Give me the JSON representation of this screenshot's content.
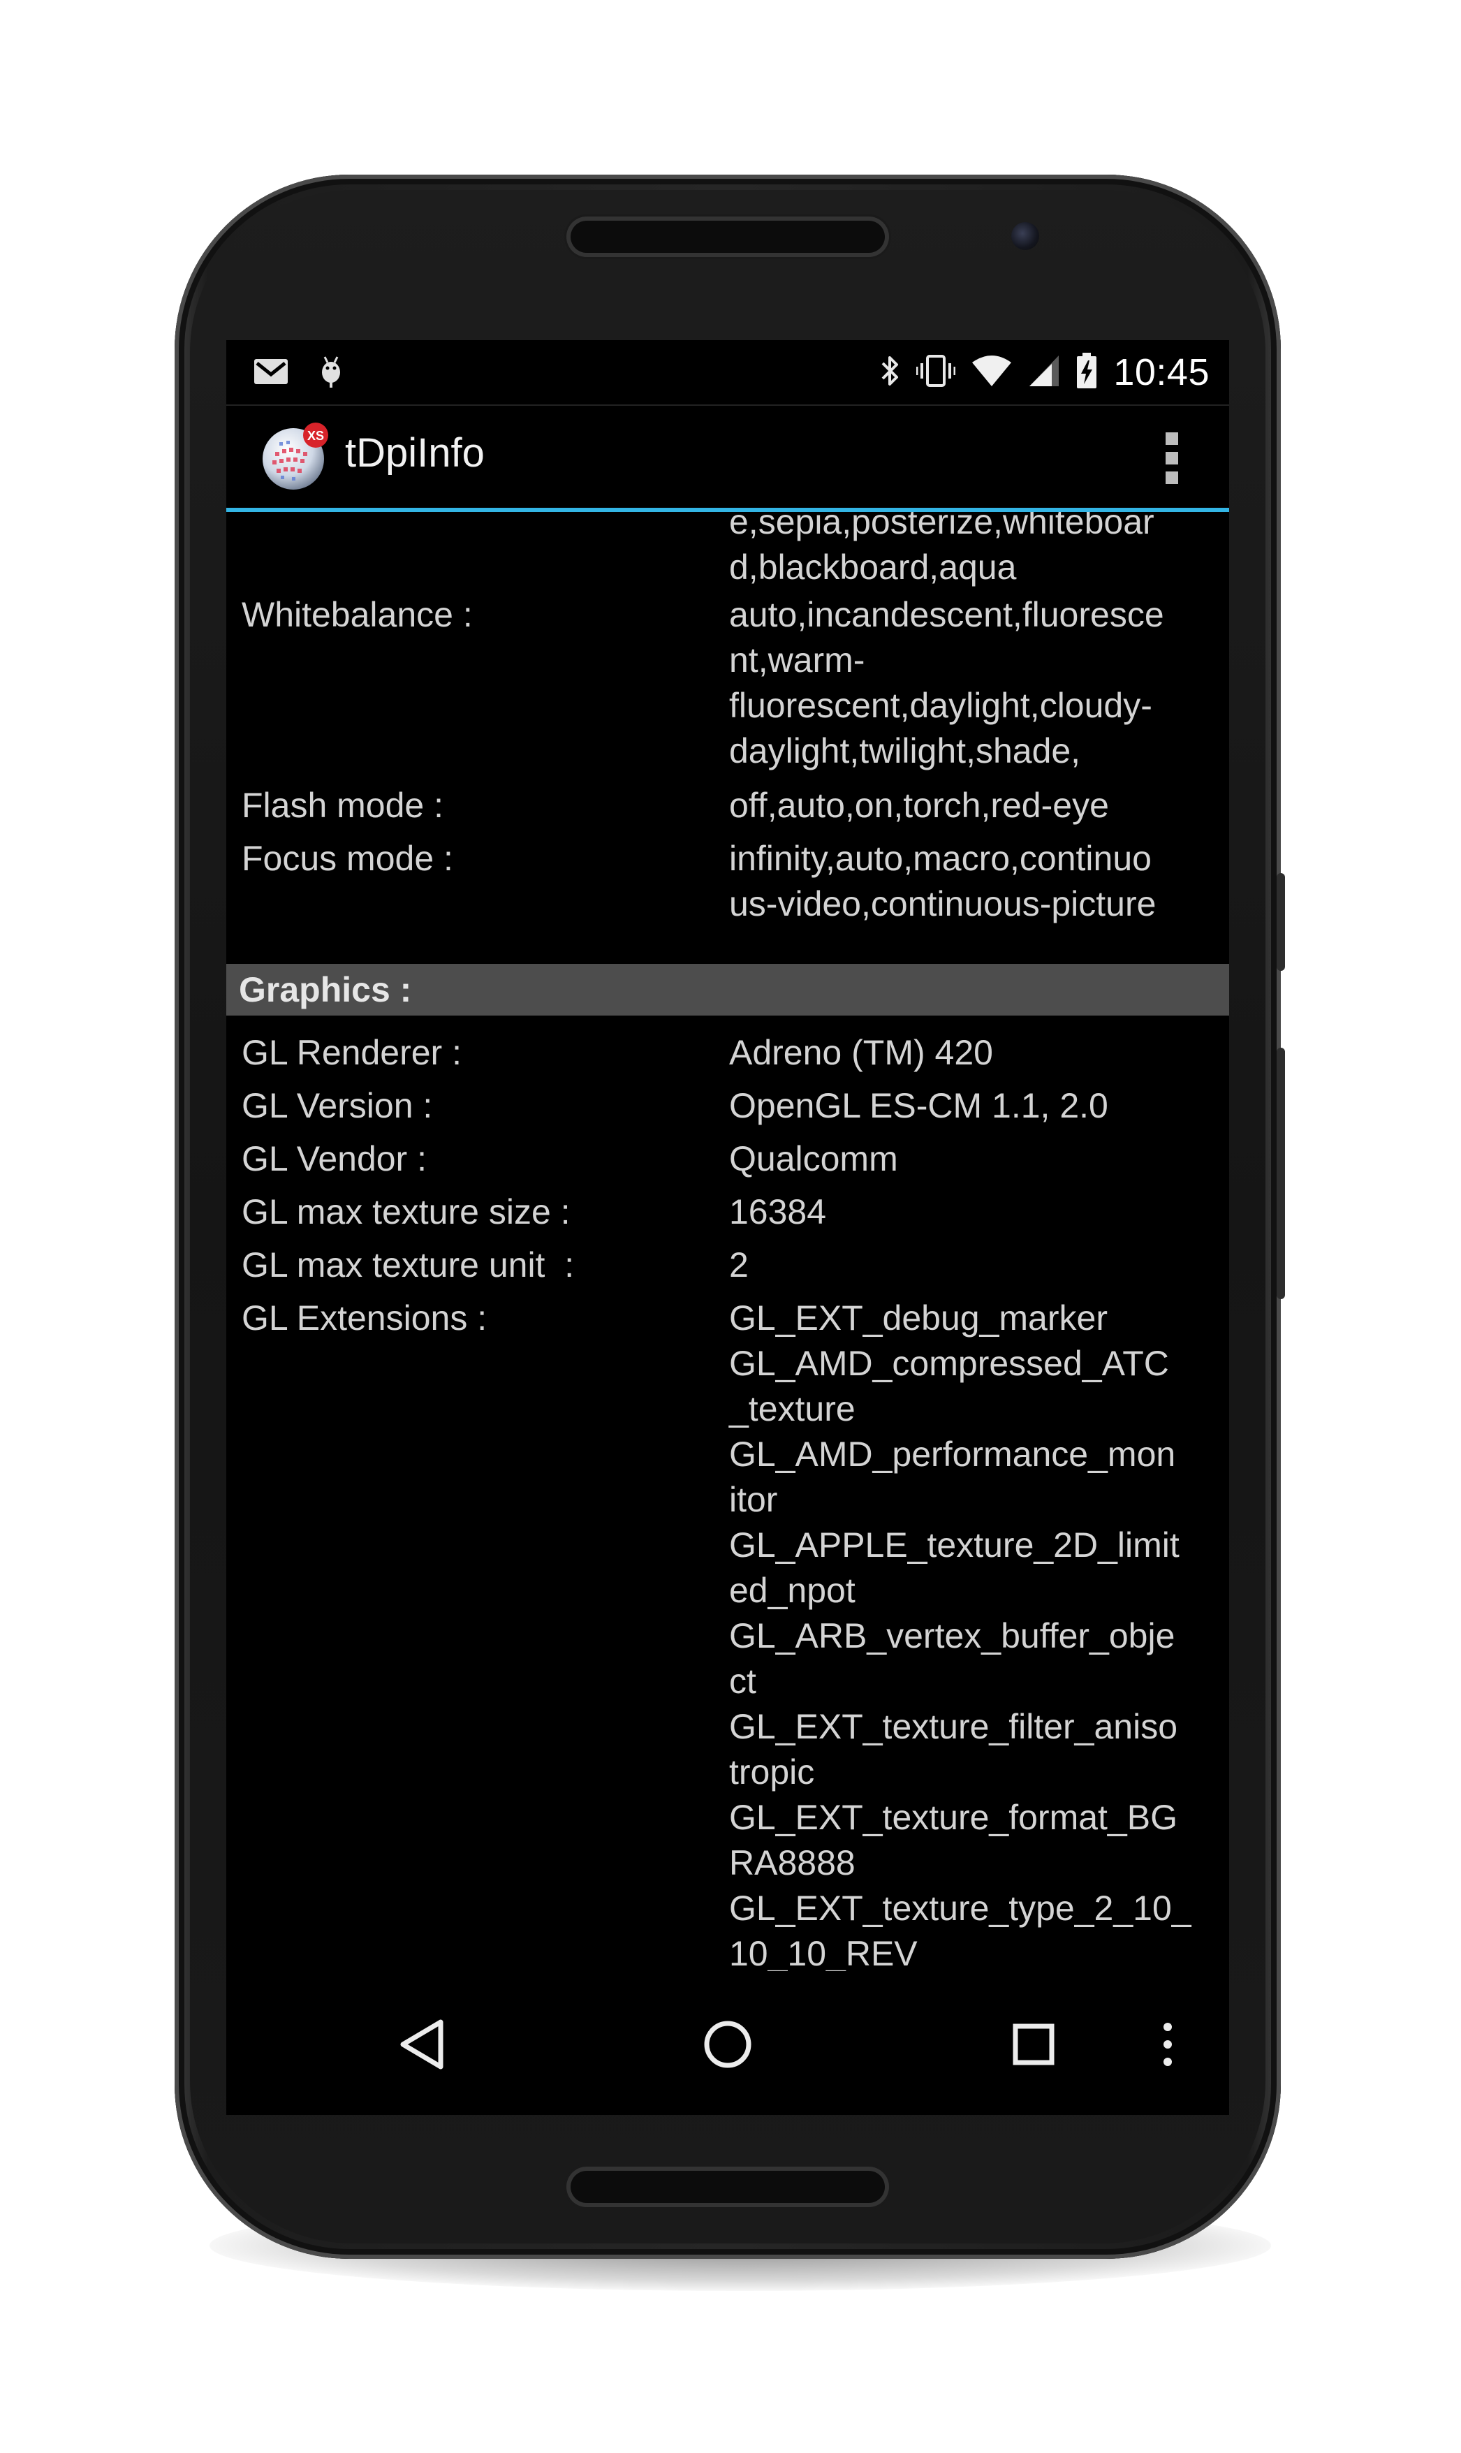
{
  "status_bar": {
    "time": "10:45",
    "left_icons": [
      "gmail-icon",
      "android-debug-icon"
    ],
    "right_icons": [
      "bluetooth-icon",
      "vibrate-icon",
      "wifi-icon",
      "cell-signal-icon",
      "battery-charging-icon"
    ]
  },
  "action_bar": {
    "app_icon": "tdpiinfo-app-icon",
    "title": "tDpiInfo",
    "overflow_icon": "overflow-menu-icon"
  },
  "camera_rows": [
    {
      "label": "",
      "value_lines": [
        "e,sepia,posterize,whiteboar",
        "d,blackboard,aqua"
      ]
    },
    {
      "label": "Whitebalance :",
      "value_lines": [
        "auto,incandescent,fluoresce",
        "nt,warm-",
        "fluorescent,daylight,cloudy-",
        "daylight,twilight,shade,"
      ]
    },
    {
      "label": "Flash mode :",
      "value_lines": [
        "off,auto,on,torch,red-eye"
      ]
    },
    {
      "label": "Focus mode :",
      "value_lines": [
        "infinity,auto,macro,continuo",
        "us-video,continuous-picture"
      ]
    }
  ],
  "graphics": {
    "header": "Graphics :",
    "rows": [
      {
        "label": "GL Renderer :",
        "value_lines": [
          "Adreno (TM) 420"
        ]
      },
      {
        "label": "GL Version :",
        "value_lines": [
          "OpenGL ES-CM 1.1, 2.0"
        ]
      },
      {
        "label": "GL Vendor :",
        "value_lines": [
          "Qualcomm"
        ]
      },
      {
        "label": "GL max texture size :",
        "value_lines": [
          "16384"
        ]
      },
      {
        "label": "GL max texture unit  :",
        "value_lines": [
          "2"
        ]
      },
      {
        "label": "GL Extensions :",
        "value_lines": [
          "GL_EXT_debug_marker",
          "GL_AMD_compressed_ATC",
          "_texture",
          "GL_AMD_performance_mon",
          "itor",
          "GL_APPLE_texture_2D_limit",
          "ed_npot",
          "GL_ARB_vertex_buffer_obje",
          "ct",
          "GL_EXT_texture_filter_aniso",
          "tropic",
          "GL_EXT_texture_format_BG",
          "RA8888",
          "GL_EXT_texture_type_2_10_",
          "10_10_REV"
        ]
      }
    ]
  },
  "nav_bar": {
    "buttons": [
      "back-icon",
      "home-icon",
      "recent-apps-icon",
      "menu-icon"
    ]
  },
  "colors": {
    "accent": "#33b5e5",
    "section_header_bg": "#4d4d4d",
    "text": "#d4d4d4",
    "background": "#000000"
  }
}
